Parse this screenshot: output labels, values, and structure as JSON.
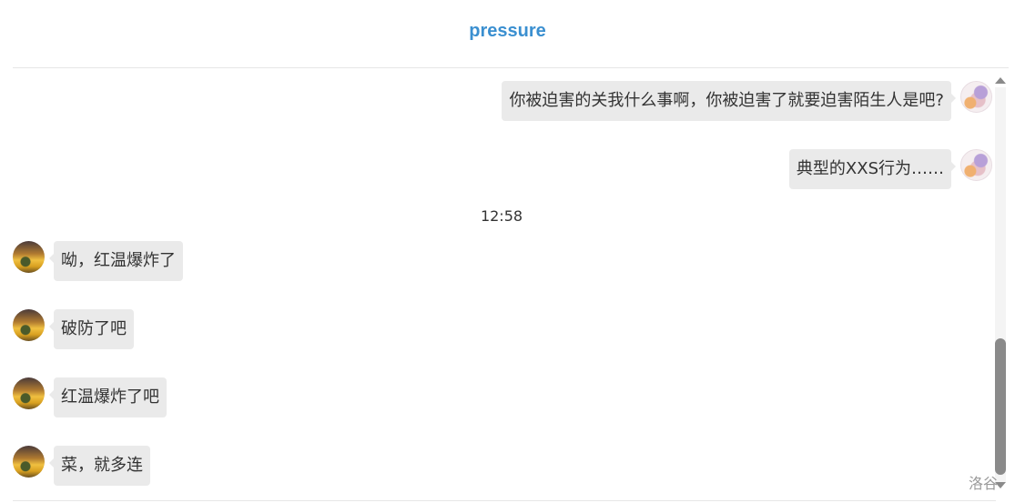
{
  "header": {
    "title": "pressure"
  },
  "messages_before": [
    {
      "direction": "out",
      "text": "你被迫害的关我什么事啊，你被迫害了就要迫害陌生人是吧?"
    },
    {
      "direction": "out",
      "text": "典型的XXS行为……"
    }
  ],
  "timestamp": "12:58",
  "messages_after": [
    {
      "direction": "in",
      "text": "呦，红温爆炸了"
    },
    {
      "direction": "in",
      "text": "破防了吧"
    },
    {
      "direction": "in",
      "text": "红温爆炸了吧"
    },
    {
      "direction": "in",
      "text": "菜，就多连"
    }
  ],
  "watermark": "洛谷",
  "colors": {
    "title": "#3a8fd0",
    "bubble": "#eaeaea",
    "text": "#333333",
    "scroll_thumb": "#8a8a8a"
  },
  "scrollbar": {
    "position_fraction": 1.0
  }
}
